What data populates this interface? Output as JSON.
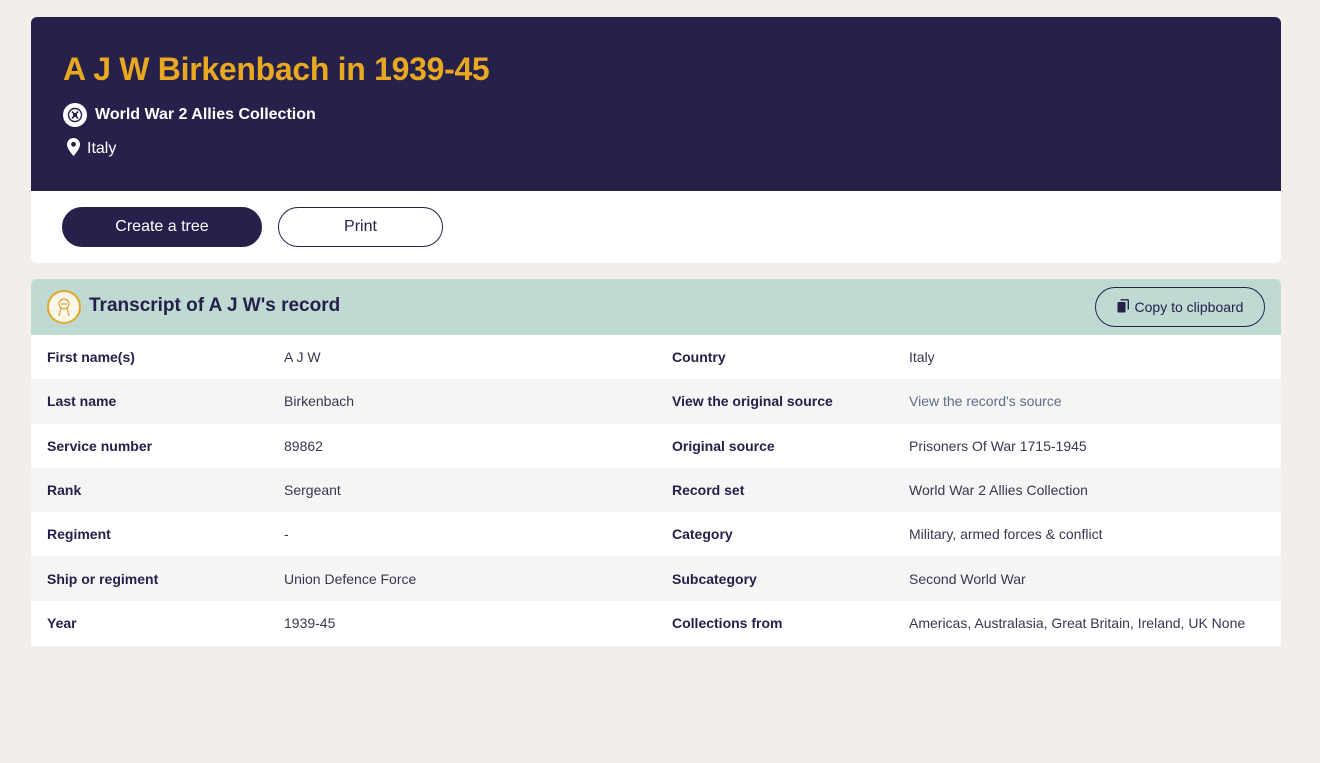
{
  "header": {
    "title": "A J W Birkenbach in 1939-45",
    "collection": "World War 2 Allies Collection",
    "location": "Italy"
  },
  "actions": {
    "create_tree": "Create a tree",
    "print": "Print"
  },
  "transcript": {
    "title": "Transcript of A J W's record",
    "copy_label": "Copy to clipboard",
    "rows": [
      {
        "k1": "First name(s)",
        "v1": "A J W",
        "k2": "Country",
        "v2": "Italy"
      },
      {
        "k1": "Last name",
        "v1": "Birkenbach",
        "k2": "View the original source",
        "v2": "View the record's source"
      },
      {
        "k1": "Service number",
        "v1": "89862",
        "k2": "Original source",
        "v2": "Prisoners Of War 1715-1945"
      },
      {
        "k1": "Rank",
        "v1": "Sergeant",
        "k2": "Record set",
        "v2": "World War 2 Allies Collection"
      },
      {
        "k1": "Regiment",
        "v1": "-",
        "k2": "Category",
        "v2": "Military, armed forces & conflict"
      },
      {
        "k1": "Ship or regiment",
        "v1": "Union Defence Force",
        "k2": "Subcategory",
        "v2": "Second World War"
      },
      {
        "k1": "Year",
        "v1": "1939-45",
        "k2": "Collections from",
        "v2": "Americas, Australasia, Great Britain, Ireland, UK None"
      }
    ]
  },
  "colors": {
    "header_bg": "#26214b",
    "title": "#e8a81f",
    "transcript_head_bg": "#bfd9d3",
    "page_bg": "#f2efeb"
  },
  "icons": {
    "collection": "military-crest-icon",
    "location": "map-pin-icon",
    "seal": "record-seal-icon",
    "copy": "copy-icon"
  }
}
